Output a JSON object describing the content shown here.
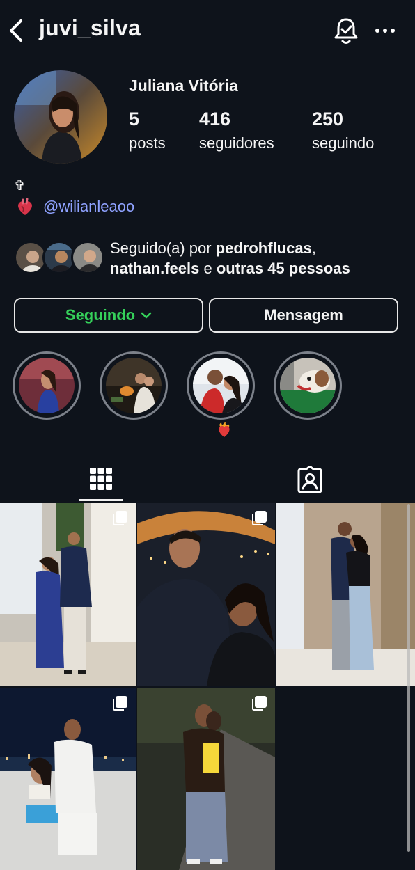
{
  "header": {
    "username": "juvi_silva",
    "back_icon": "chevron-left-icon",
    "notification_icon": "bell-check-icon",
    "more_icon": "more-horizontal-icon"
  },
  "profile": {
    "name": "Juliana Vitória",
    "stats": {
      "posts": {
        "value": "5",
        "label": "posts"
      },
      "followers": {
        "value": "416",
        "label": "seguidores"
      },
      "following": {
        "value": "250",
        "label": "seguindo"
      }
    },
    "bio_line1": "✞",
    "bio_mention": "@wilianleaoo",
    "bio_emoji_icon": "anatomical-heart-icon"
  },
  "followed_by": {
    "prefix": "Seguido(a) por ",
    "user1": "pedrohflucas",
    "comma": ",",
    "user2": "nathan.feels",
    "middle": " e ",
    "others": "outras 45 pessoas"
  },
  "actions": {
    "follow_label": "Seguindo",
    "message_label": "Mensagem"
  },
  "highlights": [
    {
      "name": "highlight-1"
    },
    {
      "name": "highlight-2"
    },
    {
      "name": "highlight-3",
      "badge": "heart-on-fire-icon"
    },
    {
      "name": "highlight-4"
    }
  ],
  "tabs": {
    "grid_icon": "grid-icon",
    "tagged_icon": "tagged-person-icon"
  },
  "colors": {
    "background": "#0e131b",
    "following_green": "#35d05a",
    "mention_blue": "#8fa2ff"
  }
}
